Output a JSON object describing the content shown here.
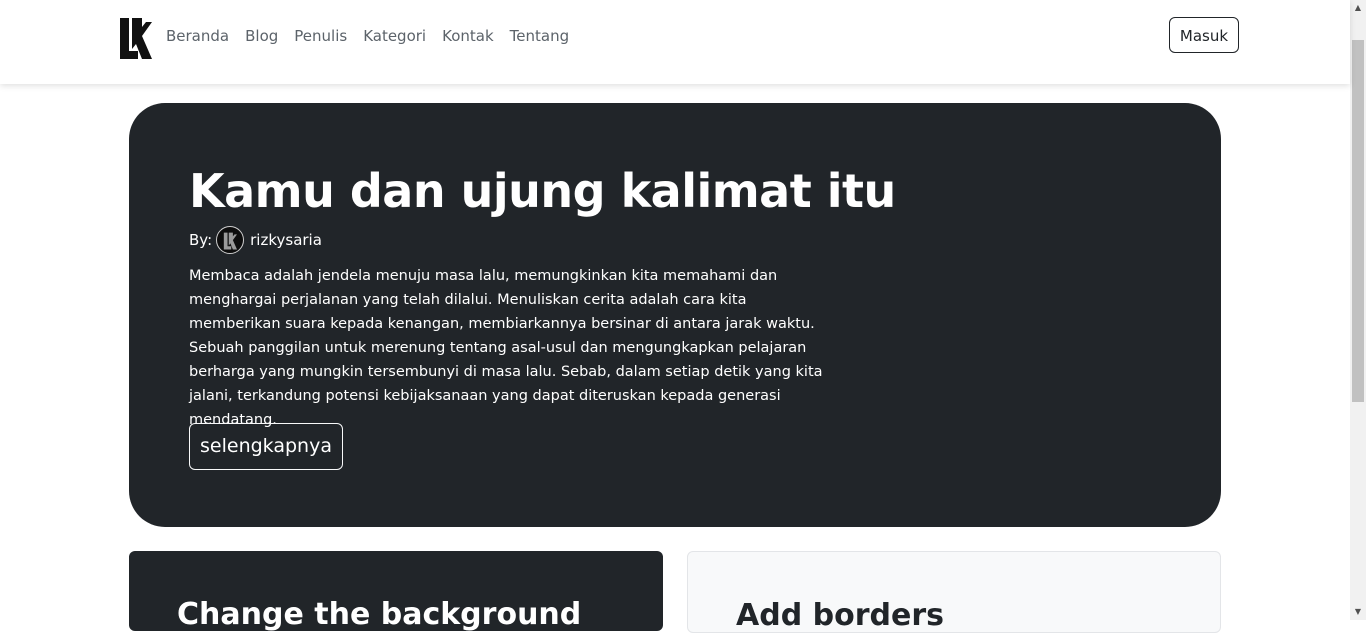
{
  "navbar": {
    "logo_icon": "brand-logo-icon",
    "links": [
      "Beranda",
      "Blog",
      "Penulis",
      "Kategori",
      "Kontak",
      "Tentang"
    ],
    "login_label": "Masuk"
  },
  "hero": {
    "title": "Kamu dan ujung kalimat itu",
    "by_label": "By:",
    "author": "rizkysaria",
    "paragraph": "Membaca adalah jendela menuju masa lalu, memungkinkan kita memahami dan menghargai perjalanan yang telah dilalui. Menuliskan cerita adalah cara kita memberikan suara kepada kenangan, membiarkannya bersinar di antara jarak waktu. Sebuah panggilan untuk merenung tentang asal-usul dan mengungkapkan pelajaran berharga yang mungkin tersembunyi di masa lalu. Sebab, dalam setiap detik yang kita jalani, terkandung potensi kebijaksanaan yang dapat diteruskan kepada generasi mendatang.",
    "button_label": "selengkapnya"
  },
  "cards": {
    "dark_title": "Change the background",
    "light_title": "Add borders"
  },
  "colors": {
    "dark": "#212529",
    "light": "#f8f9fa",
    "nav_link": "#5c636a"
  }
}
